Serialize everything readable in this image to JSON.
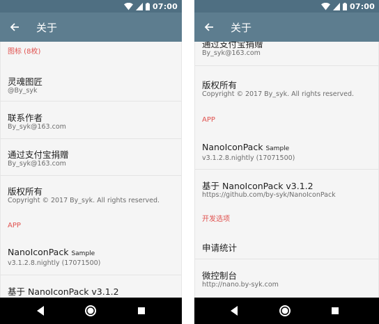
{
  "colors": {
    "appbar": "#5d7d8f",
    "statusbar": "#4f6f82",
    "accent": "#e0524f",
    "navbar": "#000000"
  },
  "status": {
    "time": "07:00",
    "icons": [
      "wifi-icon",
      "signal-icon",
      "battery-icon"
    ]
  },
  "left": {
    "title": "关于",
    "icons_header": "图标 (8枚)",
    "item1_title": "灵魂图匠",
    "item1_sum": "@By_syk",
    "item2_title": "联系作者",
    "item2_sum": "By_syk@163.com",
    "item3_title": "通过支付宝捐赠",
    "item3_sum": "By_syk@163.com",
    "item4_title": "版权所有",
    "item4_sum": "Copyright © 2017 By_syk. All rights reserved.",
    "app_header": "APP",
    "item5_title": "NanoIconPack",
    "item5_title_suffix": "Sample",
    "item5_sum": "v3.1.2.8.nightly (17071500)",
    "item6_title": "基于 NanoIconPack v3.1.2"
  },
  "right": {
    "title": "关于",
    "item1_title": "通过支付宝捐赠",
    "item1_sum": "By_syk@163.com",
    "item2_title": "版权所有",
    "item2_sum": "Copyright © 2017 By_syk. All rights reserved.",
    "app_header": "APP",
    "item3_title": "NanoIconPack",
    "item3_title_suffix": "Sample",
    "item3_sum": "v3.1.2.8.nightly (17071500)",
    "item4_title": "基于 NanoIconPack v3.1.2",
    "item4_sum": "https://github.com/by-syk/NanoIconPack",
    "dev_header": "开发选项",
    "item5_title": "申请统计",
    "item6_title": "微控制台",
    "item6_sum": "http://nano.by-syk.com"
  }
}
